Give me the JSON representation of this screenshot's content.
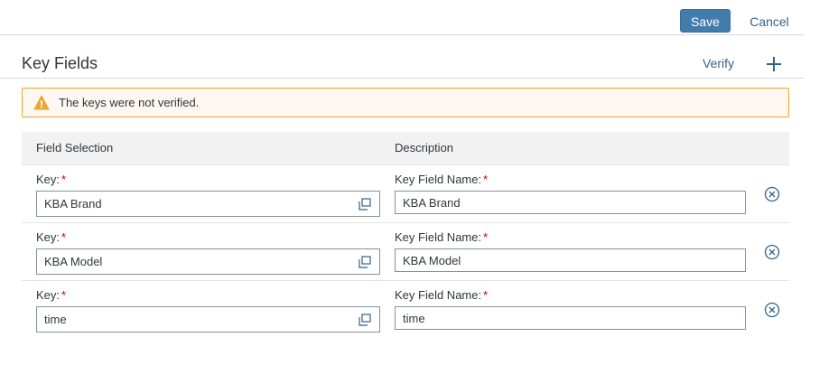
{
  "toolbar": {
    "save_label": "Save",
    "cancel_label": "Cancel"
  },
  "section": {
    "title": "Key Fields",
    "verify_label": "Verify",
    "add_icon": "add-icon"
  },
  "warning": {
    "text": "The keys were not verified.",
    "icon": "warning-icon",
    "color": "#e9a630"
  },
  "table": {
    "headers": [
      "Field Selection",
      "Description"
    ],
    "key_label": "Key:",
    "name_label": "Key Field Name:",
    "required_marker": "*",
    "rows": [
      {
        "key": "KBA Brand",
        "name": "KBA Brand"
      },
      {
        "key": "KBA Model",
        "name": "KBA Model"
      },
      {
        "key": "time",
        "name": "time"
      }
    ]
  },
  "colors": {
    "accent": "#427cac",
    "link": "#346187",
    "required": "#bb0000"
  }
}
